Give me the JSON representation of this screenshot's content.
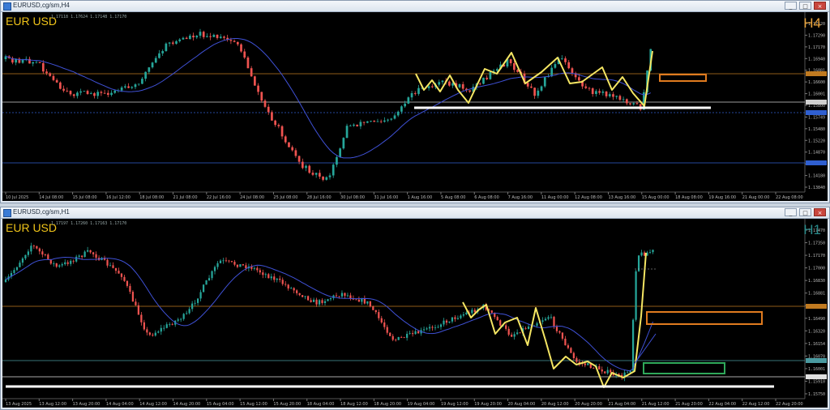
{
  "top": {
    "title": "EURUSD,cg/sm,H4",
    "symbol": "EUR USD",
    "timeframe": "H4",
    "ohlc": "1.17118 1.17624 1.17148 1.17170",
    "price_labels": [
      "1.17520",
      "1.17290",
      "1.17170",
      "1.16940",
      "1.16881",
      "1.16600",
      "1.16001",
      "1.15800",
      "1.15749",
      "1.15480",
      "1.15220",
      "1.14870",
      "1.14638",
      "1.14180",
      "1.13840"
    ],
    "time_labels": [
      "10 Jul 2025",
      "14 Jul 08:00",
      "15 Jul 08:00",
      "16 Jul 12:00",
      "18 Jul 08:00",
      "21 Jul 08:00",
      "22 Jul 16:00",
      "24 Jul 08:00",
      "25 Jul 08:00",
      "28 Jul 16:00",
      "30 Jul 08:00",
      "31 Jul 16:00",
      "1 Aug 16:00",
      "5 Aug 08:00",
      "6 Aug 08:00",
      "7 Aug 16:00",
      "11 Aug 00:00",
      "12 Aug 08:00",
      "13 Aug 16:00",
      "15 Aug 00:00",
      "18 Aug 08:00",
      "19 Aug 16:00",
      "21 Aug 00:00",
      "22 Aug 08:00"
    ]
  },
  "bottom": {
    "title": "EURUSD,cg/sm,H1",
    "symbol": "EUR USD",
    "timeframe": "H1",
    "ohlc": "1.17197 1.17260 1.17163 1.17170",
    "price_labels": [
      "1.17470",
      "1.17350",
      "1.17170",
      "1.17000",
      "1.16830",
      "1.16881",
      "1.16650",
      "1.16490",
      "1.16320",
      "1.16154",
      "1.16070",
      "1.16001",
      "1.15910",
      "1.15750"
    ],
    "time_labels": [
      "13 Aug 2025",
      "13 Aug 12:00",
      "13 Aug 20:00",
      "14 Aug 04:00",
      "14 Aug 12:00",
      "14 Aug 20:00",
      "15 Aug 04:00",
      "15 Aug 12:00",
      "15 Aug 20:00",
      "18 Aug 04:00",
      "18 Aug 12:00",
      "18 Aug 20:00",
      "19 Aug 04:00",
      "19 Aug 12:00",
      "19 Aug 20:00",
      "20 Aug 04:00",
      "20 Aug 12:00",
      "20 Aug 20:00",
      "21 Aug 04:00",
      "21 Aug 12:00",
      "21 Aug 20:00",
      "22 Aug 04:00",
      "22 Aug 12:00",
      "22 Aug 20:00"
    ]
  },
  "colors": {
    "bull": "#26a69a",
    "bear": "#ef5350",
    "ma": "#3f51d6",
    "zigzag": "#f5e663",
    "support": "#ffffff",
    "zone_orange": "#e07b1f",
    "zone_green": "#2fa85a",
    "level_orange": "#c07a20",
    "level_blue": "#2f5fd0"
  },
  "window_buttons": {
    "min": "_",
    "max": "□",
    "close": "×"
  }
}
